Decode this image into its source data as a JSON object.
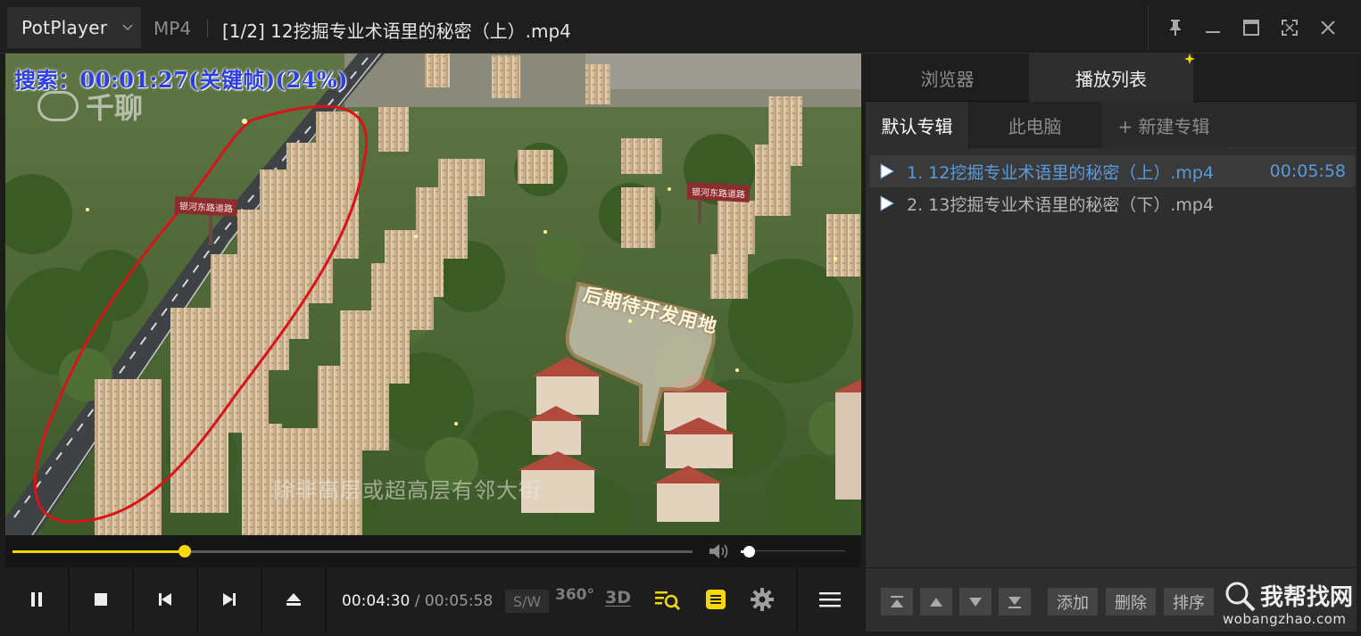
{
  "titlebar": {
    "app_name": "PotPlayer",
    "format": "MP4",
    "title": "[1/2] 12挖掘专业术语里的秘密（上）.mp4"
  },
  "video": {
    "seek_osd": "搜索：00:01:27(关键帧)(24%)",
    "watermark": "千聊",
    "subtitle": "除非高层或超高层有邻大街",
    "sign_text": "后期待开发用地",
    "billboard_left": "银河东路道路",
    "billboard_right": "银河东路道路"
  },
  "seekbar": {
    "progress_fraction": 0.253,
    "volume_fraction": 0.08
  },
  "controls": {
    "current_time": "00:04:30",
    "separator": "/",
    "duration": "00:05:58",
    "sw_label": "S/W",
    "label_360": "360°",
    "label_3d": "3D",
    "accent": "#f4d80c"
  },
  "panel": {
    "tabs": [
      {
        "label": "浏览器",
        "active": false
      },
      {
        "label": "播放列表",
        "active": true
      }
    ],
    "subtabs": [
      {
        "label": "默认专辑",
        "active": true
      },
      {
        "label": "此电脑",
        "active": false
      },
      {
        "label": "+ 新建专辑",
        "active": false
      }
    ],
    "items": [
      {
        "name": "1. 12挖掘专业术语里的秘密（上）.mp4",
        "duration": "00:05:58",
        "selected": true
      },
      {
        "name": "2. 13挖掘专业术语里的秘密（下）.mp4",
        "duration": "",
        "selected": false
      }
    ],
    "footer_buttons": {
      "add": "添加",
      "delete": "删除",
      "sort": "排序"
    },
    "selected_color": "#5a9bdc"
  },
  "site_mark": {
    "cn": "我帮找网",
    "en": "wobangzhao.com"
  }
}
